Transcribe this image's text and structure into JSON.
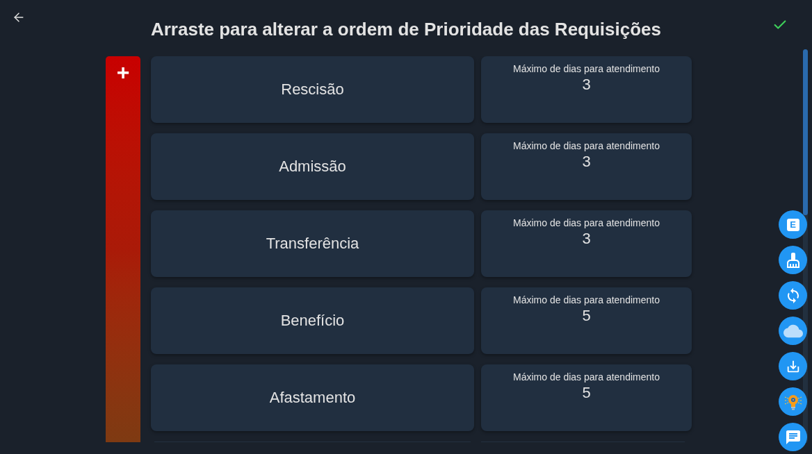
{
  "header": {
    "title": "Arraste para alterar a ordem de Prioridade das Requisições"
  },
  "priority_bar": {
    "label": "+"
  },
  "requests": [
    {
      "name": "Rescisão",
      "label": "Máximo de dias para atendimento",
      "value": "3"
    },
    {
      "name": "Admissão",
      "label": "Máximo de dias para atendimento",
      "value": "3"
    },
    {
      "name": "Transferência",
      "label": "Máximo de dias para atendimento",
      "value": "3"
    },
    {
      "name": "Benefício",
      "label": "Máximo de dias para atendimento",
      "value": "5"
    },
    {
      "name": "Afastamento",
      "label": "Máximo de dias para atendimento",
      "value": "5"
    }
  ],
  "fab_buttons": [
    {
      "kind": "letter",
      "text": "E"
    },
    {
      "kind": "brush"
    },
    {
      "kind": "sync"
    },
    {
      "kind": "cloud"
    },
    {
      "kind": "download"
    },
    {
      "kind": "bulb"
    },
    {
      "kind": "chat"
    }
  ]
}
